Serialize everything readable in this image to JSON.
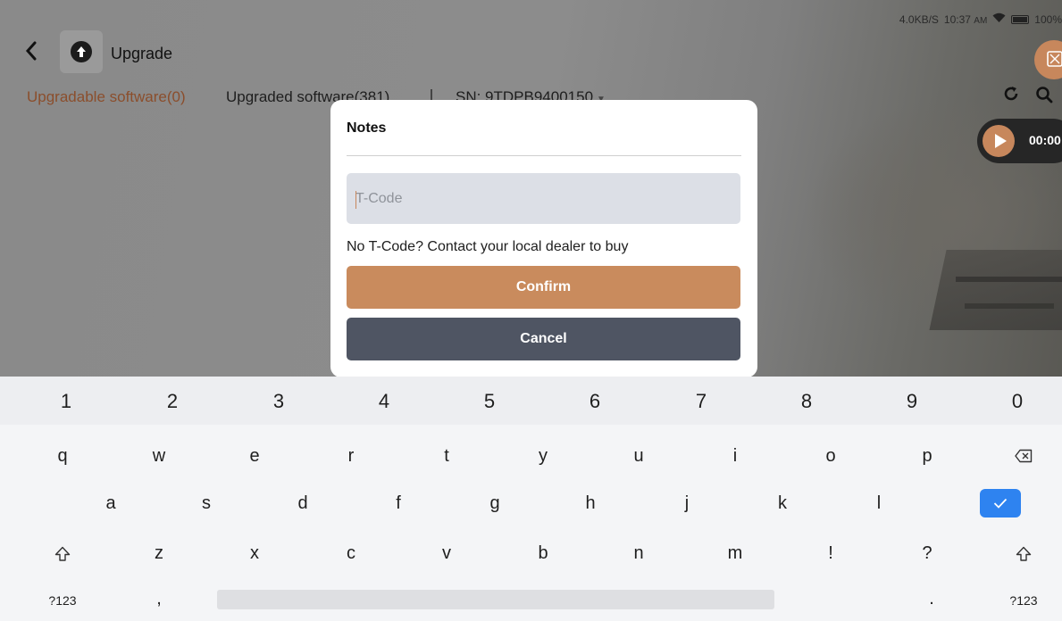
{
  "status_bar": {
    "speed": "4.0KB/S",
    "time": "10:37",
    "ampm": "AM",
    "battery": "100%"
  },
  "header": {
    "title": "Upgrade"
  },
  "tabs": {
    "upgradable": "Upgradable software(0)",
    "upgraded": "Upgraded software(381)",
    "serial": "SN: 9TDPB9400150"
  },
  "recorder": {
    "time": "00:00"
  },
  "dialog": {
    "title": "Notes",
    "input_placeholder": "T-Code",
    "hint": "No T-Code? Contact your local dealer to buy",
    "confirm_label": "Confirm",
    "cancel_label": "Cancel"
  },
  "keyboard": {
    "numbers": [
      "1",
      "2",
      "3",
      "4",
      "5",
      "6",
      "7",
      "8",
      "9",
      "0"
    ],
    "row1": [
      "q",
      "w",
      "e",
      "r",
      "t",
      "y",
      "u",
      "i",
      "o",
      "p"
    ],
    "row2": [
      "a",
      "s",
      "d",
      "f",
      "g",
      "h",
      "j",
      "k",
      "l"
    ],
    "row3": [
      "z",
      "x",
      "c",
      "v",
      "b",
      "n",
      "m",
      "!",
      "?"
    ],
    "symbols_left": "?123",
    "comma": ",",
    "period": ".",
    "symbols_right": "?123"
  },
  "colors": {
    "accent": "#c98b5d",
    "cancel": "#4f5563",
    "enter": "#2e83f0",
    "active_tab": "#8b4e2c"
  }
}
